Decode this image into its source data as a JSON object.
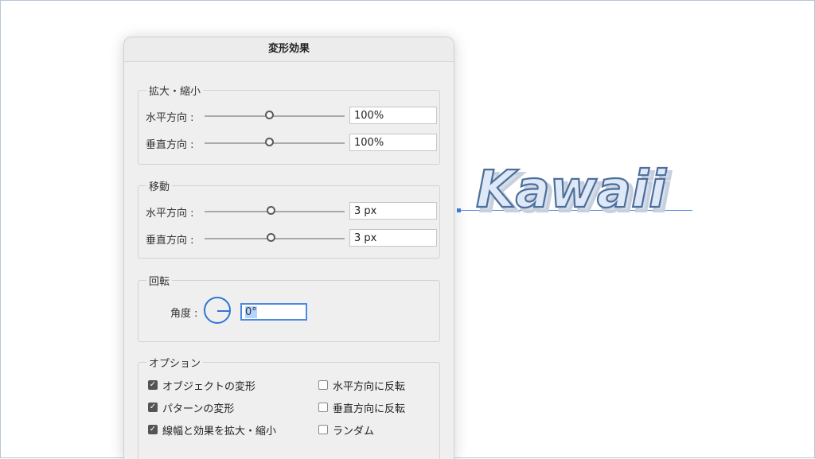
{
  "dialog": {
    "title": "変形効果",
    "scale": {
      "legend": "拡大・縮小",
      "horizontal_label": "水平方向 :",
      "horizontal_value": "100%",
      "vertical_label": "垂直方向 :",
      "vertical_value": "100%"
    },
    "move": {
      "legend": "移動",
      "horizontal_label": "水平方向 :",
      "horizontal_value": "3 px",
      "vertical_label": "垂直方向 :",
      "vertical_value": "3 px"
    },
    "rotate": {
      "legend": "回転",
      "angle_label": "角度 :",
      "angle_value": "0°"
    },
    "options": {
      "legend": "オプション",
      "transform_objects": {
        "label": "オブジェクトの変形",
        "checked": true
      },
      "transform_patterns": {
        "label": "パターンの変形",
        "checked": true
      },
      "scale_strokes": {
        "label": "線幅と効果を拡大・縮小",
        "checked": true
      },
      "reflect_x": {
        "label": "水平方向に反転",
        "checked": false
      },
      "reflect_y": {
        "label": "垂直方向に反転",
        "checked": false
      },
      "random": {
        "label": "ランダム",
        "checked": false
      }
    }
  },
  "canvas": {
    "text": "Kawaii",
    "fill_color": "#dfe8f6",
    "stroke_color": "#4d6f9c",
    "shadow_color": "#d6deea"
  },
  "colors": {
    "accent": "#2f76d6",
    "selection": "#b4d4ff"
  }
}
